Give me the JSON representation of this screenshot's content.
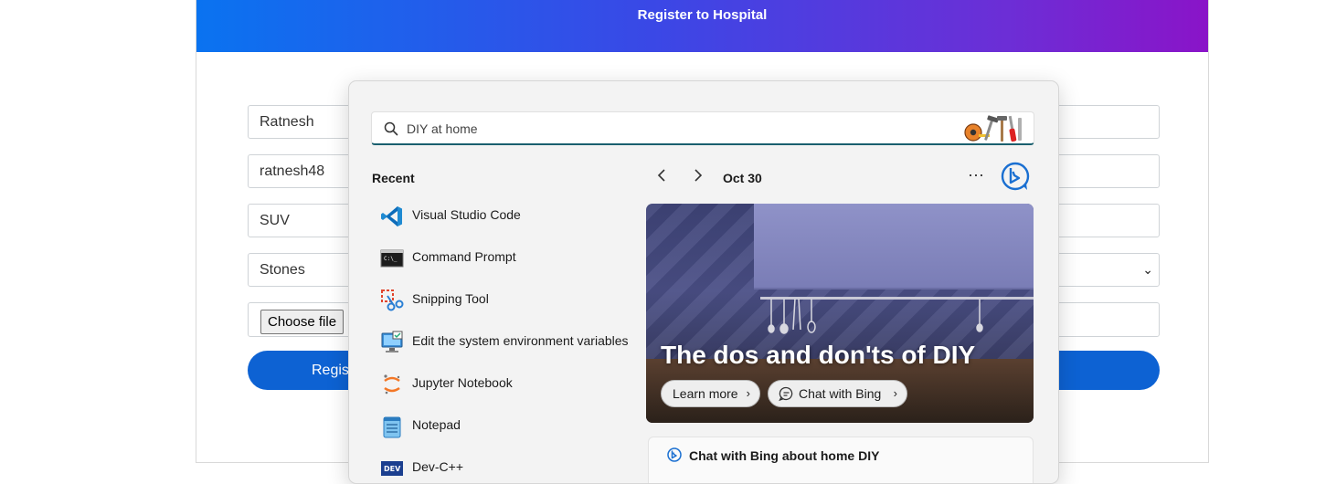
{
  "registration": {
    "title": "Register to Hospital",
    "fields": {
      "first_name": "Ratnesh",
      "username": "ratnesh48",
      "vehicle": "SUV",
      "selected_option": "Stones"
    },
    "file_button": "Choose file",
    "submit_label": "Regist"
  },
  "flyout": {
    "search": {
      "value": "DIY at home",
      "icon": "search-icon"
    },
    "recent_title": "Recent",
    "apps": [
      {
        "label": "Visual Studio Code",
        "icon": "vscode-icon"
      },
      {
        "label": "Command Prompt",
        "icon": "command-prompt-icon"
      },
      {
        "label": "Snipping Tool",
        "icon": "snipping-tool-icon"
      },
      {
        "label": "Edit the system environment variables",
        "icon": "system-properties-icon"
      },
      {
        "label": "Jupyter Notebook",
        "icon": "jupyter-icon"
      },
      {
        "label": "Notepad",
        "icon": "notepad-icon"
      },
      {
        "label": "Dev-C++",
        "icon": "devcpp-icon"
      }
    ],
    "date": "Oct 30",
    "hero": {
      "title": "The dos and don'ts of DIY",
      "learn_more": "Learn more",
      "chat_with_bing": "Chat with Bing"
    },
    "chat_card": "Chat with Bing about home DIY"
  },
  "colors": {
    "header_gradient_start": "#0a73f0",
    "header_gradient_end": "#8a14c8",
    "submit_button": "#0d62d3",
    "search_underline": "#1a5f6e"
  }
}
